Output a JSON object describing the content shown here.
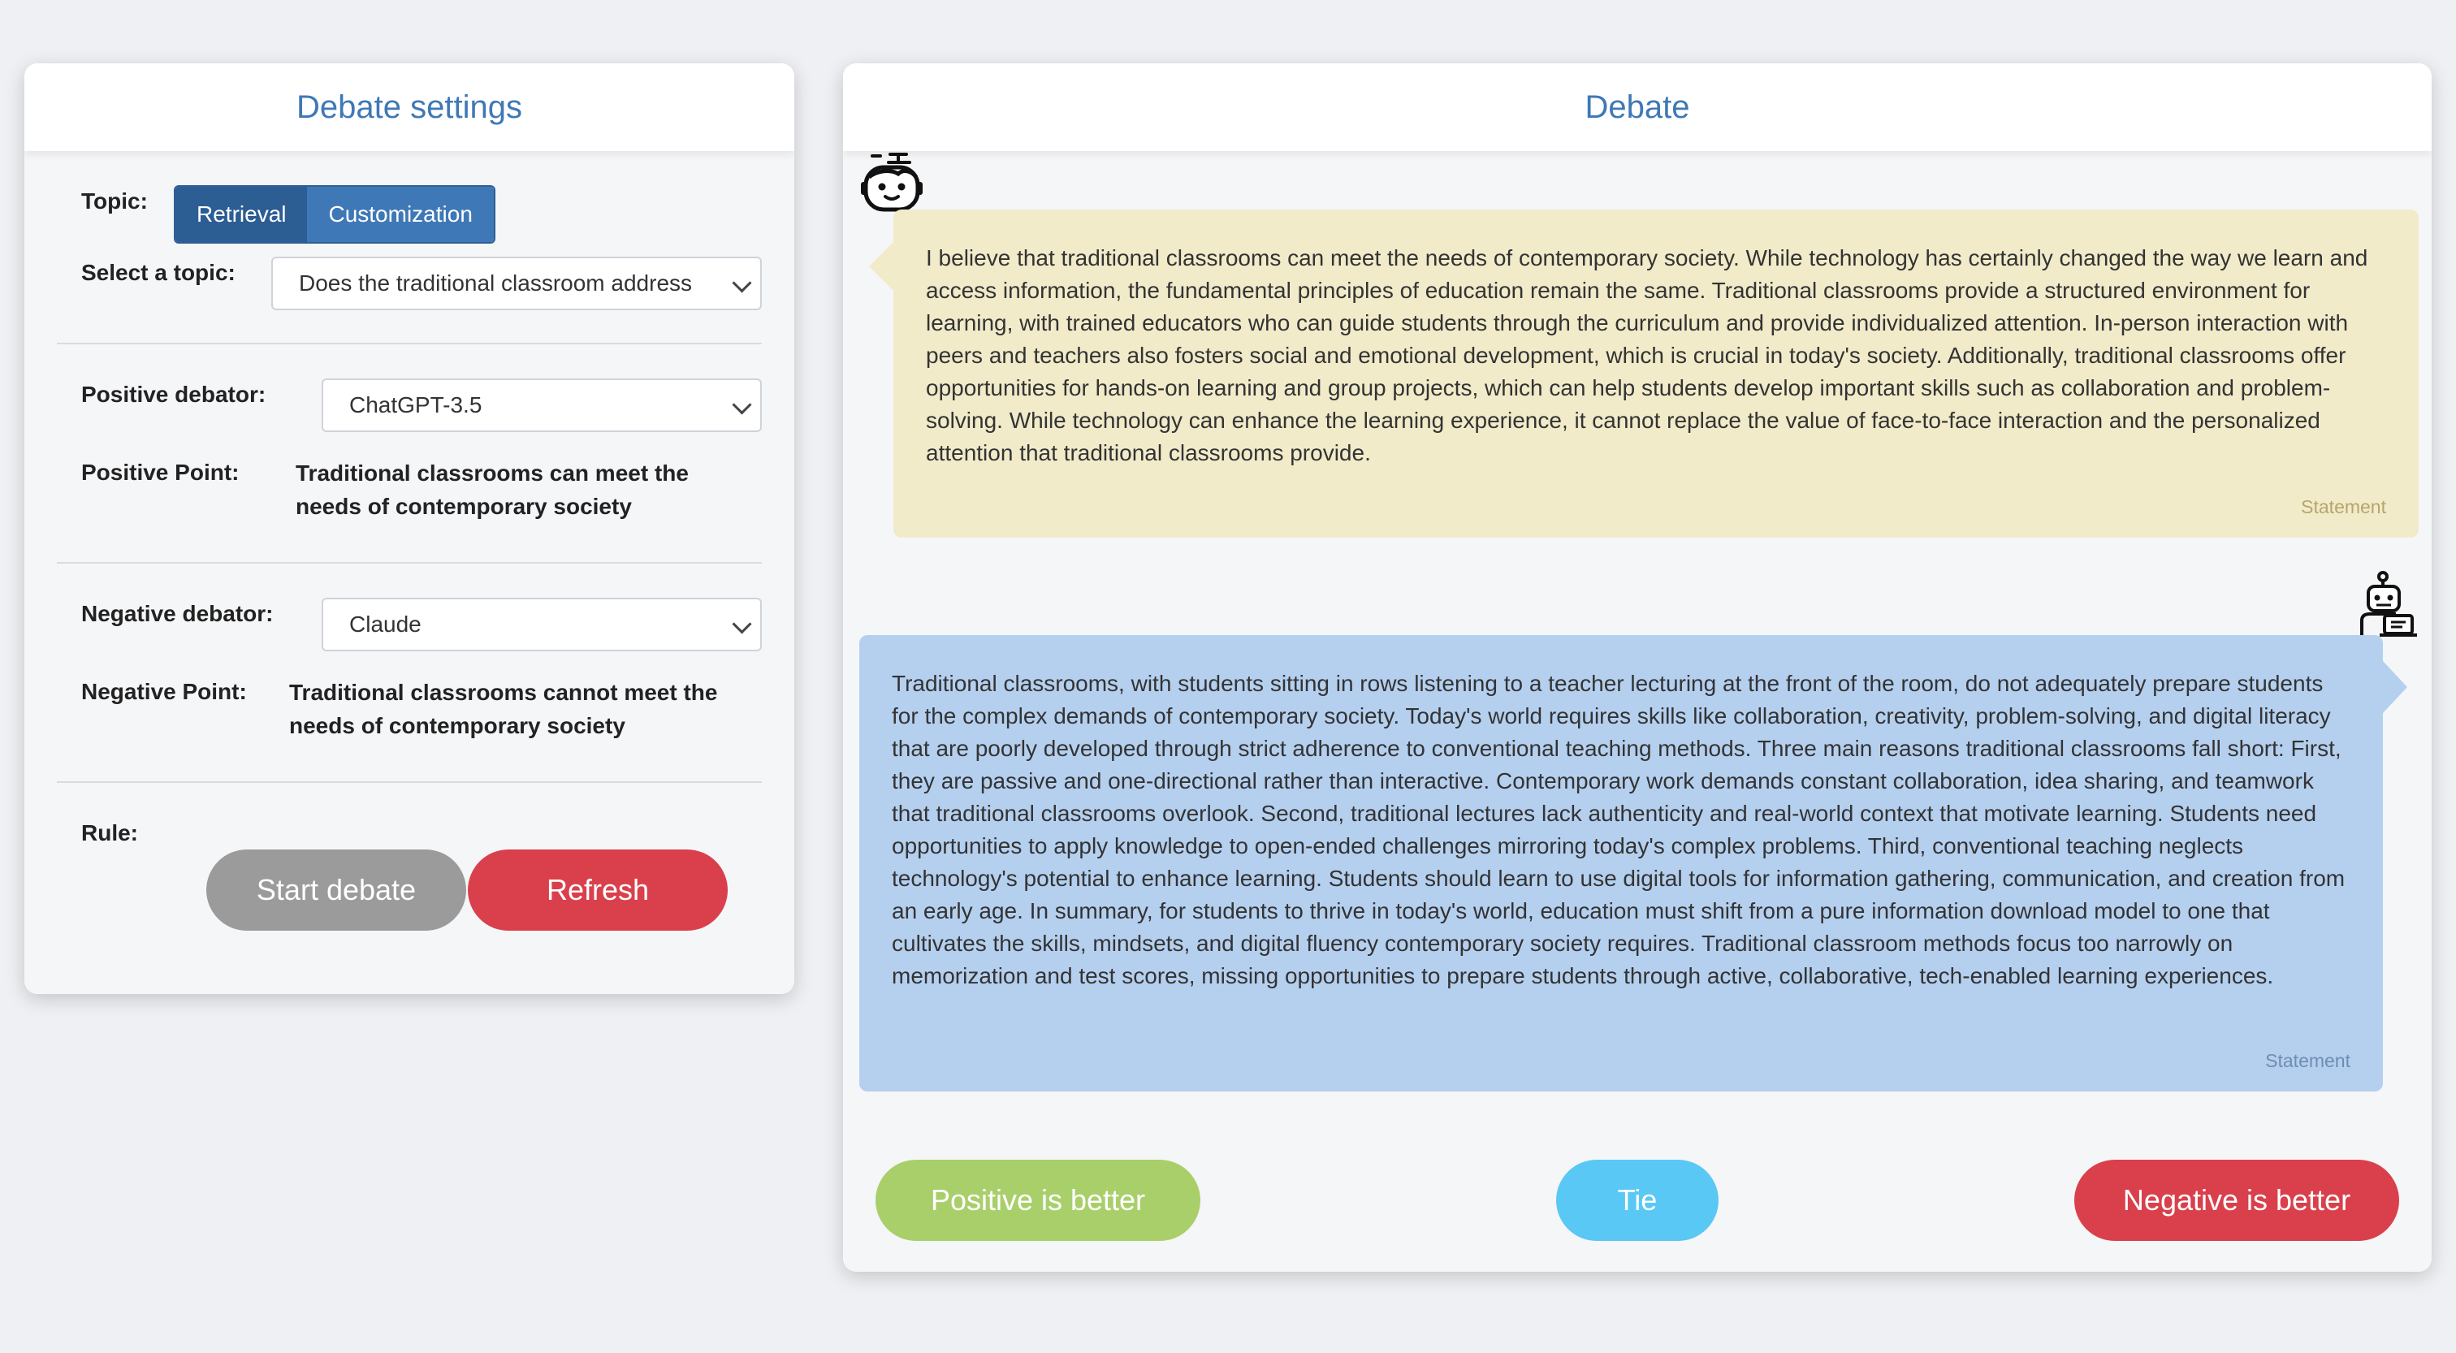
{
  "settings": {
    "title": "Debate settings",
    "topic_label": "Topic:",
    "topic_modes": [
      "Retrieval",
      "Customization"
    ],
    "select_topic_label": "Select a topic:",
    "selected_topic": "Does the traditional classroom address",
    "positive_debator_label": "Positive debator:",
    "positive_debator": "ChatGPT-3.5",
    "positive_point_label": "Positive Point:",
    "positive_point_lines": [
      "Traditional classrooms can meet the",
      "needs of contemporary society"
    ],
    "negative_debator_label": "Negative debator:",
    "negative_debator": "Claude",
    "negative_point_label": "Negative Point:",
    "negative_point_lines": [
      "Traditional classrooms cannot meet the",
      "needs of contemporary society"
    ],
    "rule_label": "Rule:",
    "start_button": "Start debate",
    "refresh_button": "Refresh"
  },
  "debate": {
    "title": "Debate",
    "messages": [
      {
        "side": "positive",
        "text": "I believe that traditional classrooms can meet the needs of contemporary society. While technology has certainly changed the way we learn and access information, the fundamental principles of education remain the same. Traditional classrooms provide a structured environment for learning, with trained educators who can guide students through the curriculum and provide individualized attention. In-person interaction with peers and teachers also fosters social and emotional development, which is crucial in today's society. Additionally, traditional classrooms offer opportunities for hands-on learning and group projects, which can help students develop important skills such as collaboration and problem-solving. While technology can enhance the learning experience, it cannot replace the value of face-to-face interaction and the personalized attention that traditional classrooms provide.",
        "tag": "Statement"
      },
      {
        "side": "negative",
        "text": "Traditional classrooms, with students sitting in rows listening to a teacher lecturing at the front of the room, do not adequately prepare students for the complex demands of contemporary society. Today's world requires skills like collaboration, creativity, problem-solving, and digital literacy that are poorly developed through strict adherence to conventional teaching methods. Three main reasons traditional classrooms fall short: First, they are passive and one-directional rather than interactive. Contemporary work demands constant collaboration, idea sharing, and teamwork that traditional classrooms overlook. Second, traditional lectures lack authenticity and real-world context that motivate learning. Students need opportunities to apply knowledge to open-ended challenges mirroring today's complex problems. Third, conventional teaching neglects technology's potential to enhance learning. Students should learn to use digital tools for information gathering, communication, and creation from an early age. In summary, for students to thrive in today's world, education must shift from a pure information download model to one that cultivates the skills, mindsets, and digital fluency contemporary society requires. Traditional classroom methods focus too narrowly on memorization and test scores, missing opportunities to prepare students through active, collaborative, tech-enabled learning experiences.",
        "tag": "Statement"
      }
    ],
    "vote_positive": "Positive is better",
    "vote_tie": "Tie",
    "vote_negative": "Negative is better"
  },
  "colors": {
    "accent": "#3f78b6",
    "positive_bubble": "#f1ebca",
    "negative_bubble": "#b5d0ef",
    "start_button": "#9b9b9b",
    "refresh_button": "#d9404b",
    "vote_positive": "#a9cf6b",
    "vote_tie": "#5ac8f5",
    "vote_negative": "#d9404b"
  },
  "icons": {
    "positive_avatar": "robot-head-icon",
    "negative_avatar": "robot-laptop-icon"
  }
}
